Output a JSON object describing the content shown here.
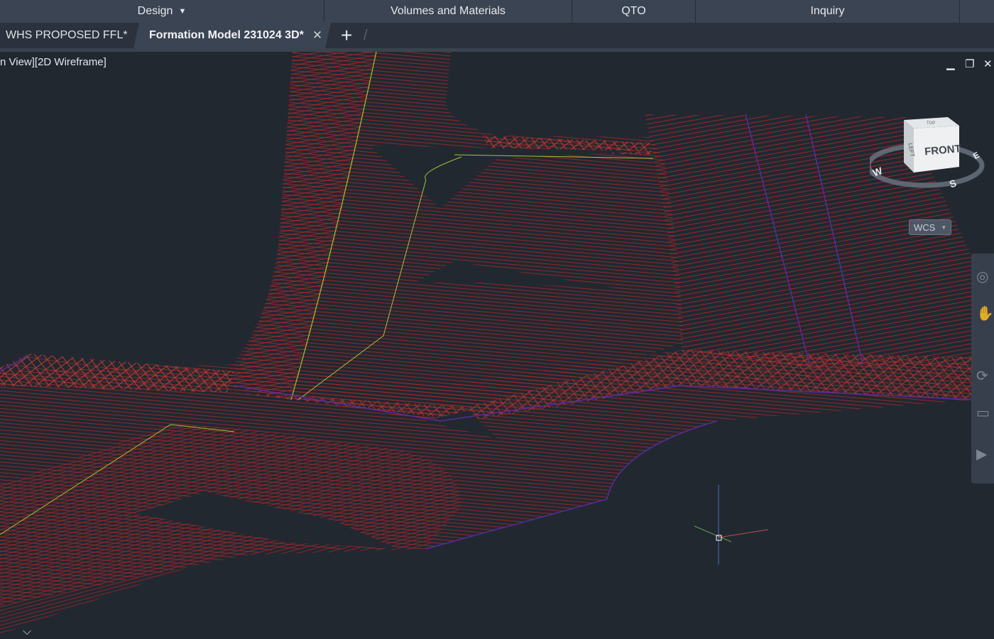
{
  "ribbon": {
    "panels": [
      {
        "label": "Design",
        "dropdown": true
      },
      {
        "label": "Volumes and Materials",
        "dropdown": false
      },
      {
        "label": "QTO",
        "dropdown": false
      },
      {
        "label": "Inquiry",
        "dropdown": false
      }
    ]
  },
  "tabs": {
    "inactive_label": "WHS PROPOSED FFL*",
    "active_label": "Formation Model 231024 3D*",
    "close_glyph": "✕",
    "new_tab_glyph": "+"
  },
  "viewport": {
    "label": "n View][2D Wireframe]",
    "controls": {
      "minimize": "▁",
      "restore": "❐",
      "close": "✕"
    }
  },
  "viewcube": {
    "face_front": "FRONT",
    "face_left": "LEFT",
    "face_top": "TOP",
    "compass": {
      "west": "W",
      "south": "S",
      "east": "E"
    }
  },
  "wcs": {
    "label": "WCS"
  },
  "colors": {
    "background": "#212830",
    "wireframe": "#b3262b",
    "boundary": "#5a2aa0",
    "alignment": "#9bc62a",
    "ribbon": "#3b4453"
  },
  "icons": [
    "chevron-down-icon",
    "close-icon",
    "plus-icon",
    "minimize-icon",
    "restore-icon",
    "steering-wheel-icon",
    "pan-icon",
    "orbit-icon",
    "showmotion-icon",
    "ucs-icon"
  ]
}
